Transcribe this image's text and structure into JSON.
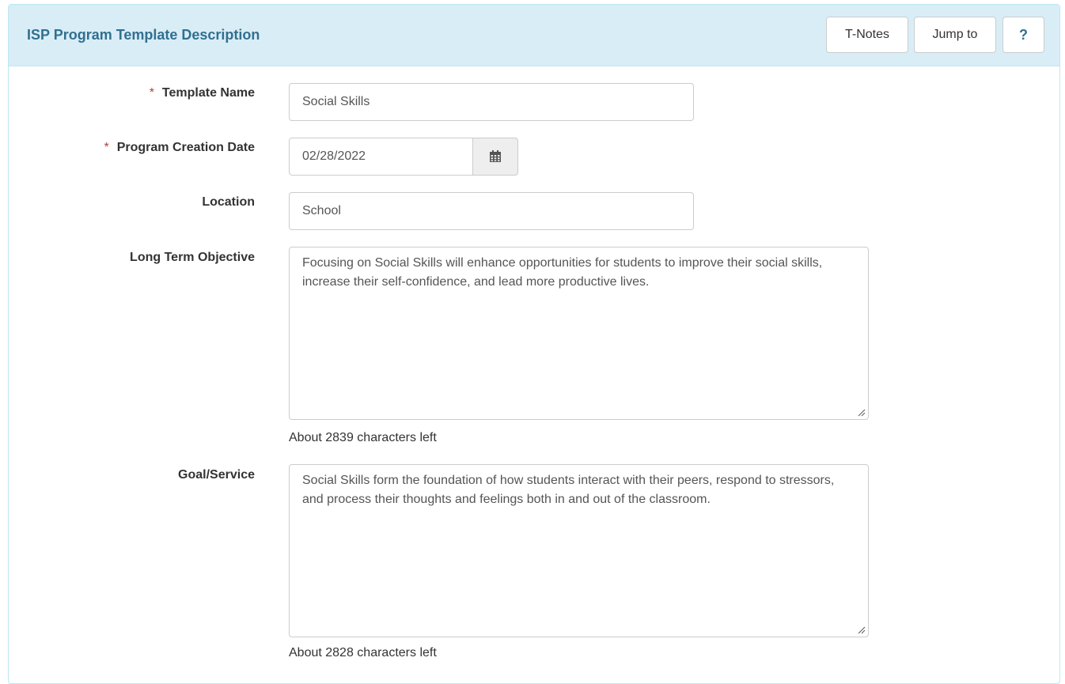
{
  "header": {
    "title": "ISP Program Template Description",
    "buttons": {
      "tnotes": "T-Notes",
      "jump_to": "Jump to",
      "help": "?"
    }
  },
  "form": {
    "required_marker": "*",
    "template_name": {
      "label": "Template Name",
      "value": "Social Skills",
      "required": true
    },
    "program_creation_date": {
      "label": "Program Creation Date",
      "value": "02/28/2022",
      "required": true,
      "icon": "calendar-icon"
    },
    "location": {
      "label": "Location",
      "value": "School"
    },
    "long_term_objective": {
      "label": "Long Term Objective",
      "value": "Focusing on Social Skills will enhance opportunities for students to improve their social skills, increase their self-confidence, and lead more productive lives.",
      "chars_left": "About 2839 characters left"
    },
    "goal_service": {
      "label": "Goal/Service",
      "value": "Social Skills form the foundation of how students interact with their peers, respond to stressors, and process their thoughts and feelings both in and out of the classroom.",
      "chars_left": "About 2828 characters left"
    }
  },
  "colors": {
    "heading_bg": "#d9edf7",
    "heading_text": "#31708f",
    "required": "#a94442"
  }
}
